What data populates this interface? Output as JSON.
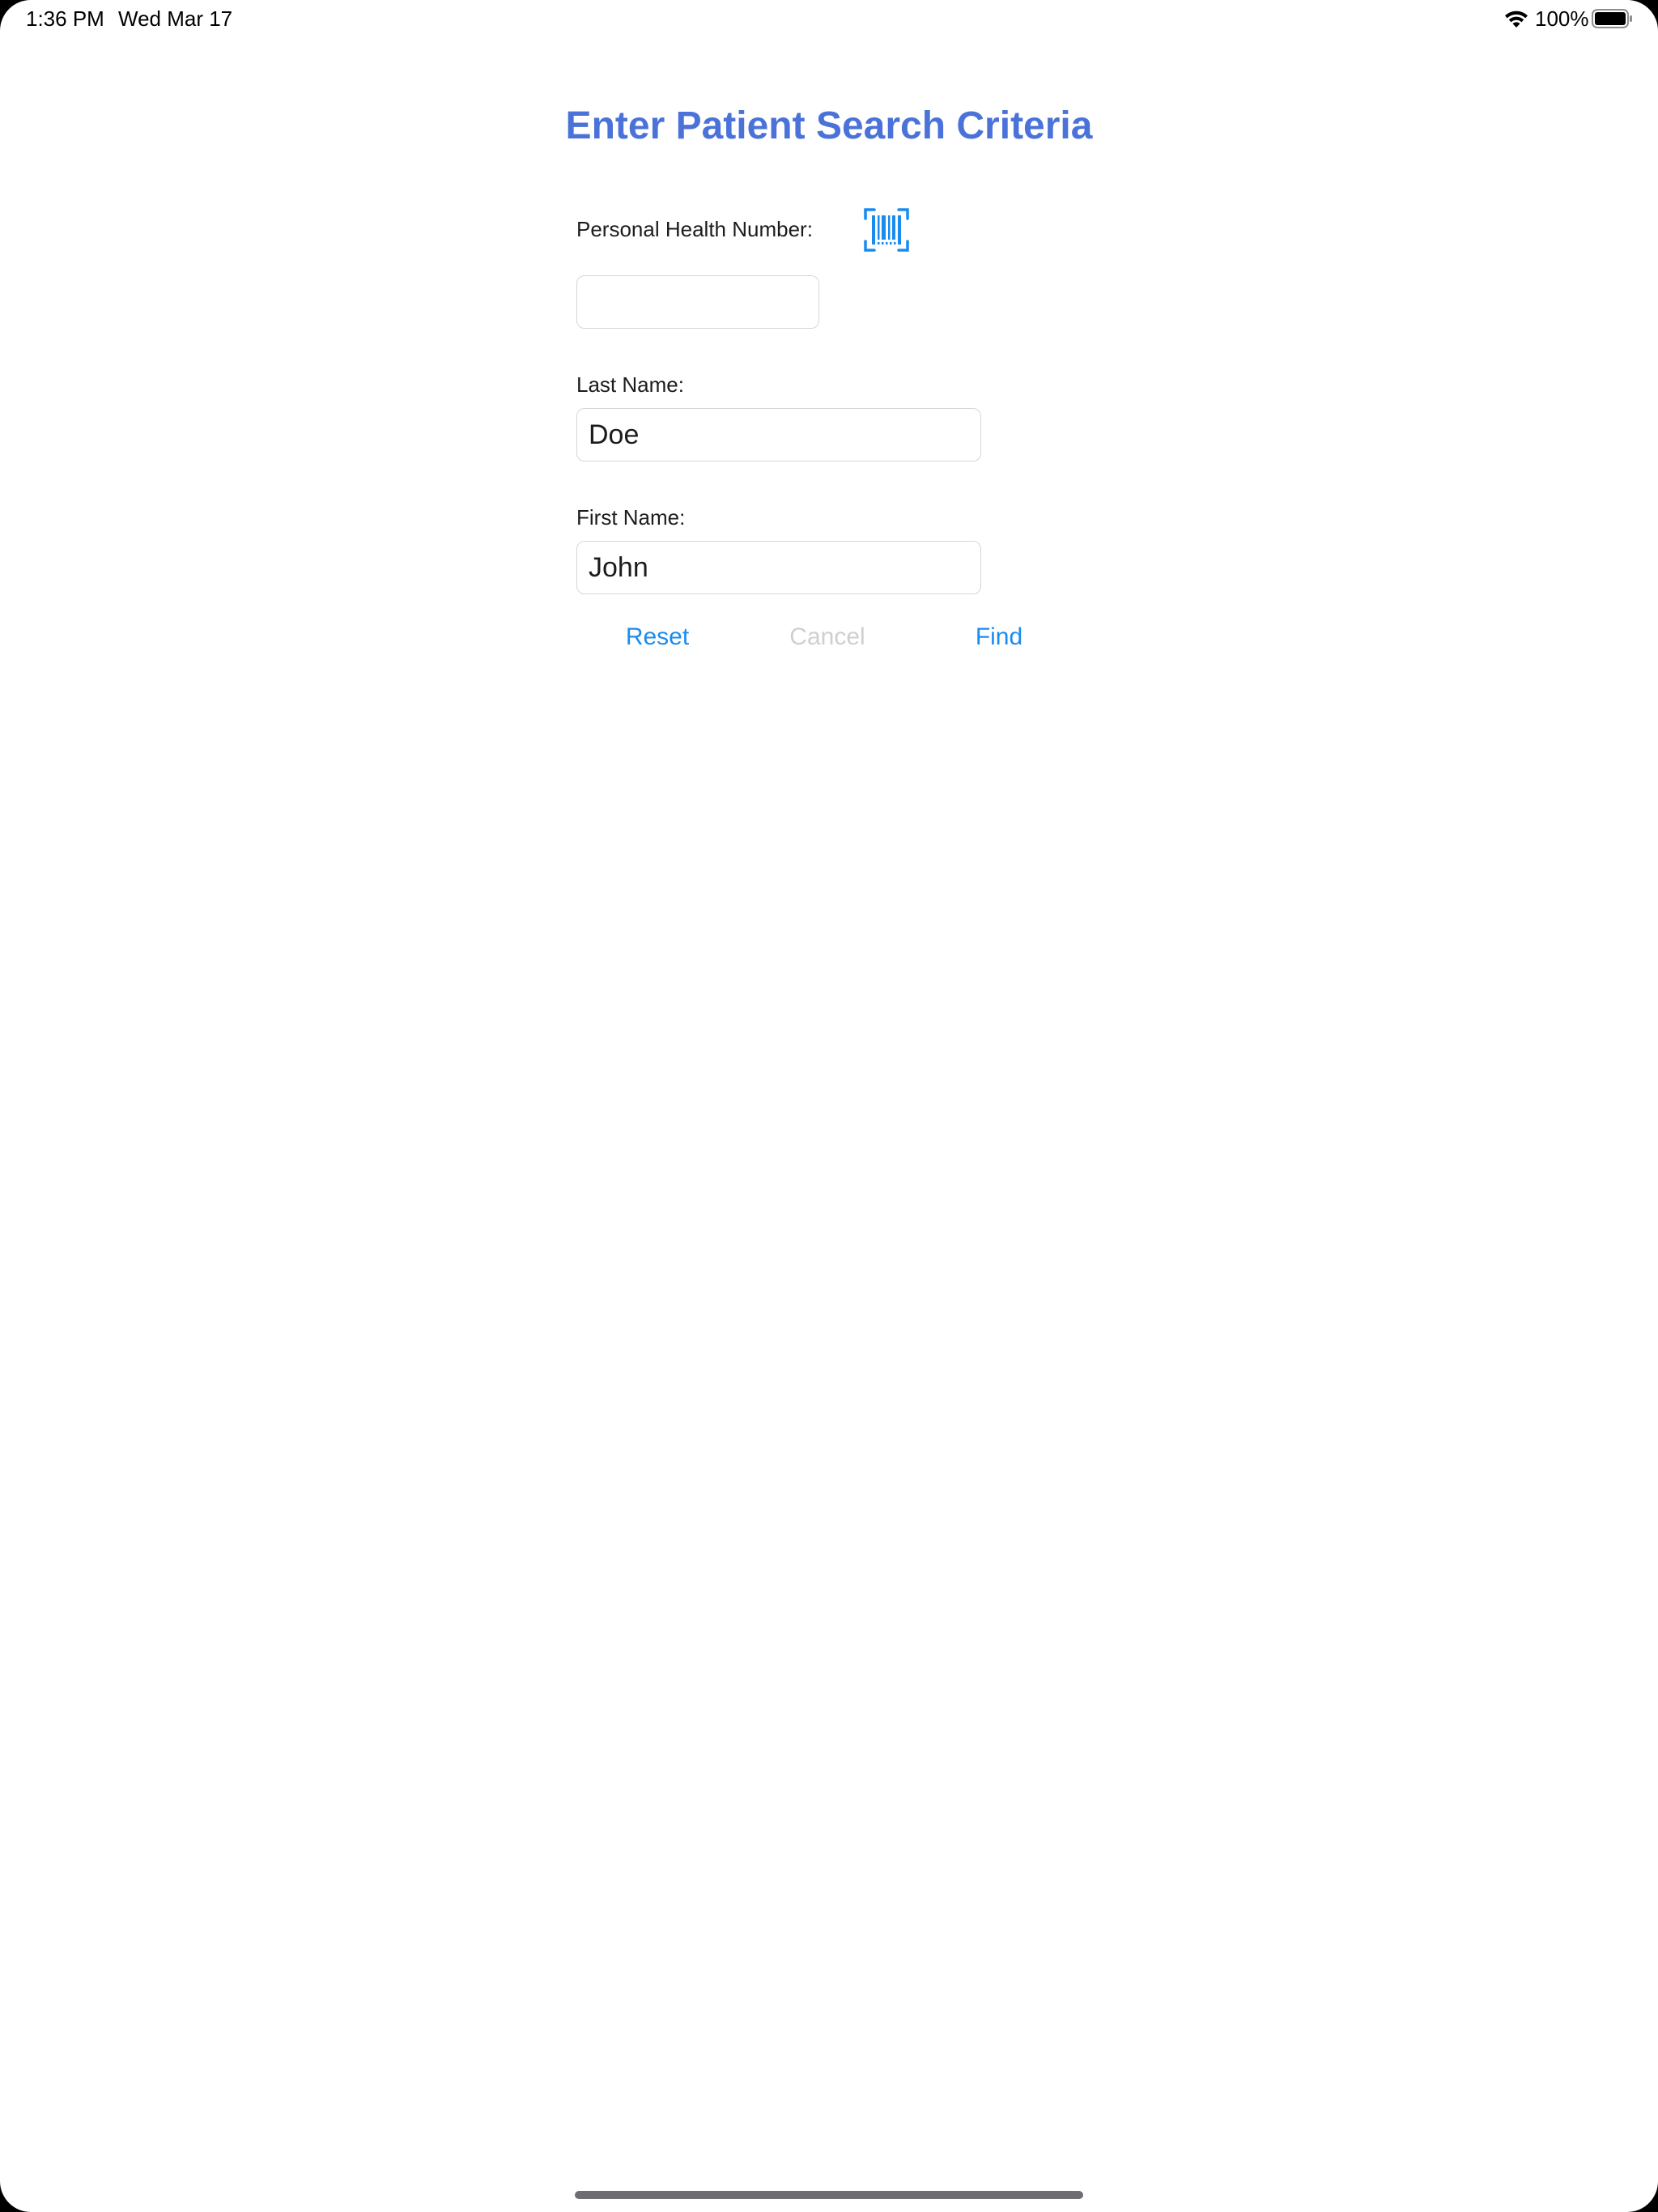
{
  "status_bar": {
    "time": "1:36 PM",
    "date": "Wed Mar 17",
    "battery_percent": "100%",
    "wifi_icon": "wifi-icon",
    "battery_icon": "battery-icon"
  },
  "form": {
    "title": "Enter Patient Search Criteria",
    "phn": {
      "label": "Personal Health Number:",
      "value": "",
      "scan_icon": "barcode-scan-icon"
    },
    "last_name": {
      "label": "Last Name:",
      "value": "Doe"
    },
    "first_name": {
      "label": "First Name:",
      "value": "John"
    }
  },
  "actions": {
    "reset": "Reset",
    "cancel": "Cancel",
    "find": "Find"
  },
  "colors": {
    "title": "#4a72d9",
    "accent": "#1a8cf0",
    "disabled": "#cfcfd3"
  }
}
